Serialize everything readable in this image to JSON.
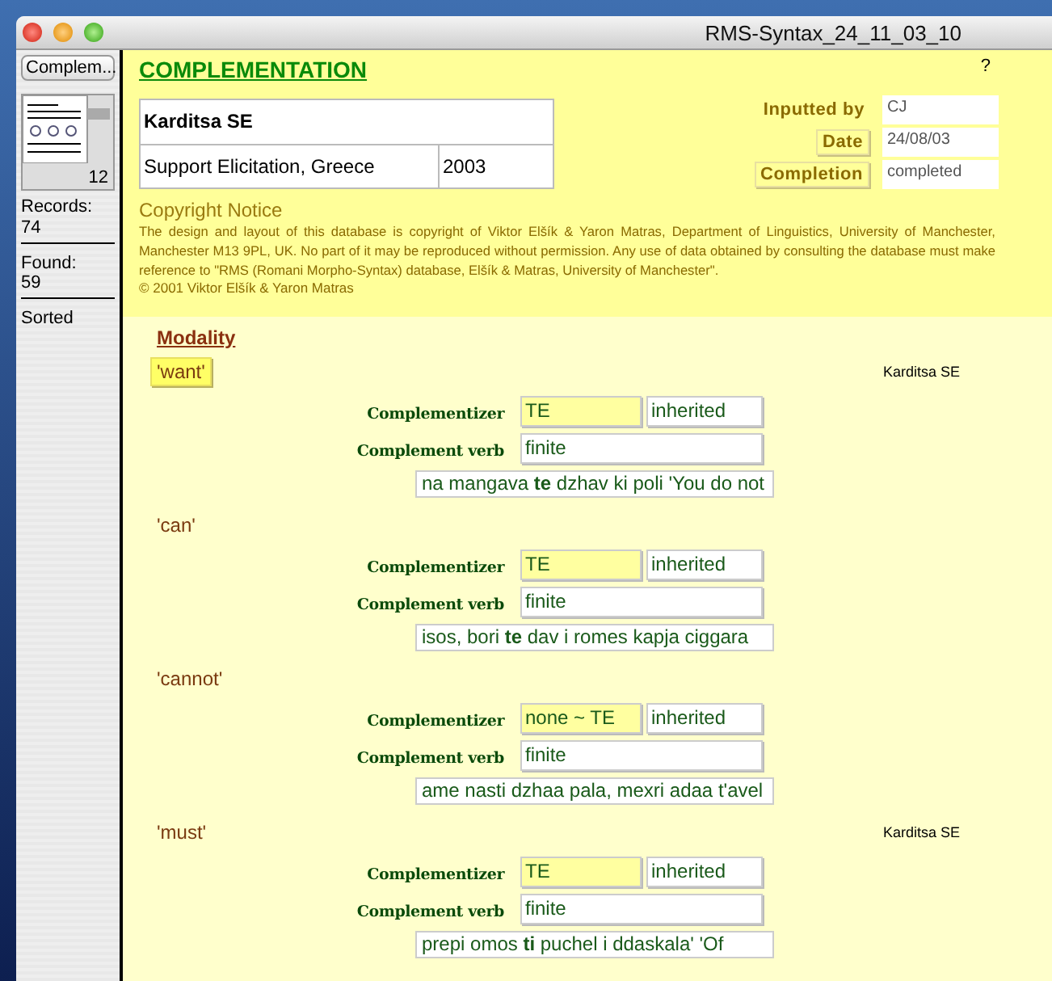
{
  "window": {
    "title": "RMS-Syntax_24_11_03_10"
  },
  "sidebar": {
    "layout_button": "Complem...",
    "record_count": "12",
    "records_label": "Records:",
    "records": "74",
    "found_label": "Found:",
    "found": "59",
    "sort_state": "Sorted"
  },
  "header": {
    "title": "COMPLEMENTATION",
    "help": "?",
    "location": "Karditsa SE",
    "source": "Support Elicitation, Greece",
    "year": "2003",
    "meta": [
      {
        "label": "Inputted by",
        "kind": "plain",
        "value": "CJ"
      },
      {
        "label": "Date",
        "kind": "button",
        "value": "24/08/03"
      },
      {
        "label": "Completion",
        "kind": "button",
        "value": "completed"
      }
    ],
    "copyright_title": "Copyright Notice",
    "copyright_text": "The design and layout of this database is copyright of Viktor Elšík & Yaron Matras, Department of Linguistics, University of Manchester, Manchester M13 9PL, UK. No part of it may be reproduced without permission. Any use of data obtained by consulting the database must make reference to \"RMS (Romani Morpho-Syntax) database, Elšík & Matras, University of Manchester\".",
    "copyright_line": "© 2001 Viktor Elšík & Yaron Matras"
  },
  "heading": "Modality",
  "sections": [
    {
      "label": "'want'",
      "selected": true,
      "location": "Karditsa SE",
      "complementizer_label": "Complementizer",
      "complementizer": "TE",
      "origin": "inherited",
      "verb_label": "Complement verb",
      "verb": "finite",
      "example": "na mangava **te** dzhav ki poli 'You do not"
    },
    {
      "label": "'can'",
      "selected": false,
      "complementizer_label": "Complementizer",
      "complementizer": "TE",
      "origin": "inherited",
      "verb_label": "Complement verb",
      "verb": "finite",
      "example": "isos, bori **te** dav i romes kapja ciggara"
    },
    {
      "label": "'cannot'",
      "selected": false,
      "complementizer_label": "Complementizer",
      "complementizer": "none ~ TE",
      "origin": "inherited",
      "verb_label": "Complement verb",
      "verb": "finite",
      "example": "ame nasti dzhaa pala, mexri adaa t'avel"
    },
    {
      "label": "'must'",
      "selected": false,
      "location": "Karditsa SE",
      "complementizer_label": "Complementizer",
      "complementizer": "TE",
      "origin": "inherited",
      "verb_label": "Complement verb",
      "verb": "finite",
      "example": "prepi omos **ti** puchel i ddaskala'  'Of"
    }
  ]
}
